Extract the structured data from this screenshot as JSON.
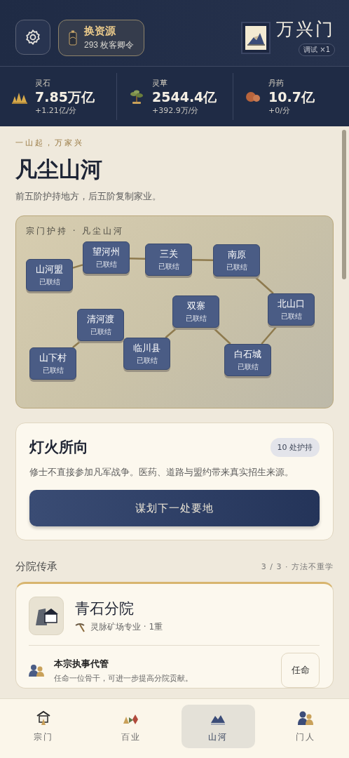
{
  "header": {
    "source_button": {
      "title": "换资源",
      "subtitle": "293 枚客卿令"
    },
    "sect": {
      "name": "万兴门",
      "badge": "调试 ×1"
    }
  },
  "resources": [
    {
      "kind": "stone",
      "label": "灵石",
      "value": "7.85万亿",
      "rate": "+1.21亿/分"
    },
    {
      "kind": "herb",
      "label": "灵草",
      "value": "2544.4亿",
      "rate": "+392.9万/分"
    },
    {
      "kind": "pill",
      "label": "丹药",
      "value": "10.7亿",
      "rate": "+0/分"
    }
  ],
  "page": {
    "tagline": "一山起，万家兴",
    "title": "凡尘山河",
    "subtitle": "前五阶护持地方，后五阶复制家业。"
  },
  "map": {
    "caption": "宗门护持 · 凡尘山河",
    "nodes": [
      {
        "name": "山河盟",
        "status": "已联结"
      },
      {
        "name": "望河州",
        "status": "已联结"
      },
      {
        "name": "三关",
        "status": "已联结"
      },
      {
        "name": "南原",
        "status": "已联结"
      },
      {
        "name": "北山口",
        "status": "已联结"
      },
      {
        "name": "白石城",
        "status": "已联结"
      },
      {
        "name": "双寨",
        "status": "已联结"
      },
      {
        "name": "临川县",
        "status": "已联结"
      },
      {
        "name": "清河渡",
        "status": "已联结"
      },
      {
        "name": "山下村",
        "status": "已联结"
      }
    ]
  },
  "beacon_card": {
    "title": "灯火所向",
    "badge": "10 处护持",
    "description": "修士不直接参加凡军战争。医药、道路与盟约带来真实招生来源。",
    "button": "谋划下一处要地"
  },
  "branches": {
    "title": "分院传承",
    "summary": "3 / 3 · 方法不重学",
    "items": [
      {
        "name": "青石分院",
        "specialty": "灵脉矿场专业 · 1重",
        "steward": {
          "title": "本宗执事代管",
          "description": "任命一位骨干，可进一步提高分院贡献。",
          "button": "任命"
        }
      }
    ]
  },
  "tabs": [
    {
      "kind": "sect",
      "label": "宗门",
      "selected": false
    },
    {
      "kind": "trades",
      "label": "百业",
      "selected": false
    },
    {
      "kind": "realm",
      "label": "山河",
      "selected": true
    },
    {
      "kind": "people",
      "label": "门人",
      "selected": false
    }
  ]
}
